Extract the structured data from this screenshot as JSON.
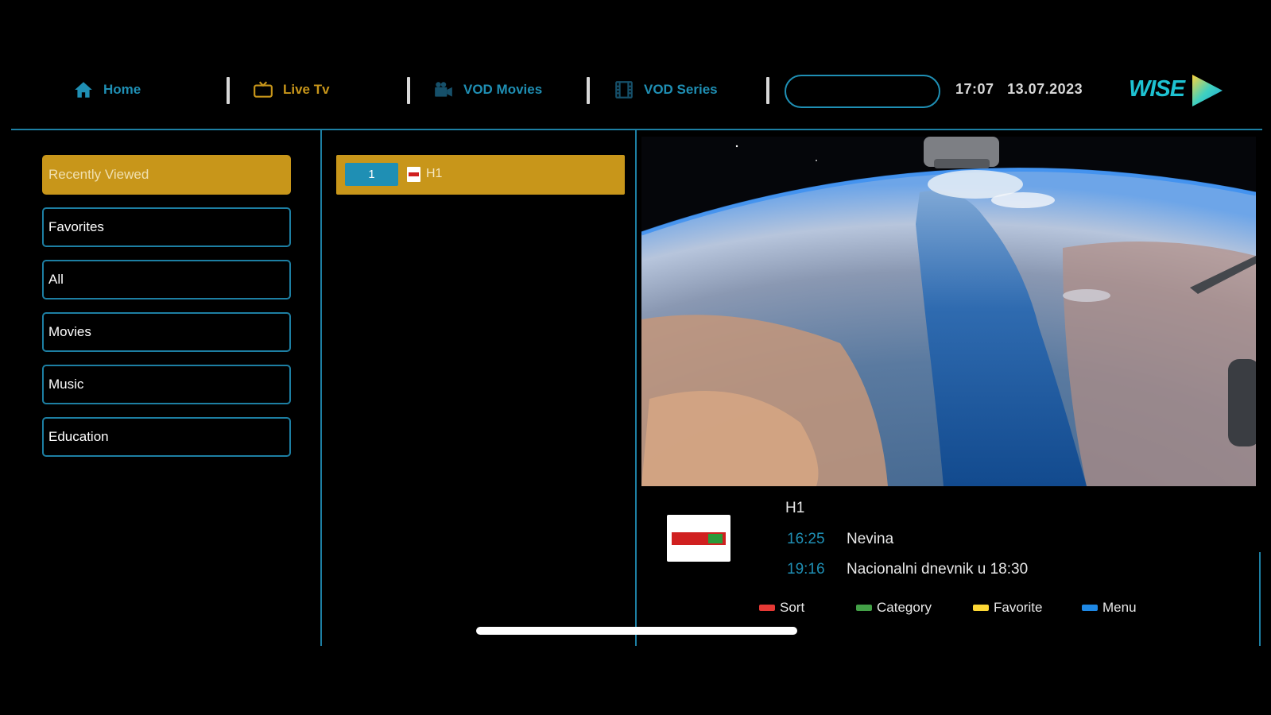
{
  "nav": {
    "home": "Home",
    "live_tv": "Live Tv",
    "vod_movies": "VOD Movies",
    "vod_series": "VOD Series",
    "time": "17:07",
    "date": "13.07.2023",
    "logo_text": "WISE"
  },
  "categories": [
    {
      "label": "Recently Viewed"
    },
    {
      "label": "Favorites"
    },
    {
      "label": "All"
    },
    {
      "label": "Movies"
    },
    {
      "label": "Music"
    },
    {
      "label": "Education"
    }
  ],
  "channels": [
    {
      "number": "1",
      "name": "H1"
    }
  ],
  "epg": {
    "channel": "H1",
    "programs": [
      {
        "time": "16:25",
        "title": "Nevina"
      },
      {
        "time": "19:16",
        "title": "Nacionalni dnevnik u 18:30"
      }
    ]
  },
  "legend": {
    "sort": "Sort",
    "category": "Category",
    "favorite": "Favorite",
    "menu": "Menu"
  },
  "colors": {
    "accent": "#1f8fb4",
    "selected": "#c8961a",
    "sort": "#e53935",
    "category": "#43a047",
    "favorite": "#fdd835",
    "menu": "#1e88e5"
  }
}
